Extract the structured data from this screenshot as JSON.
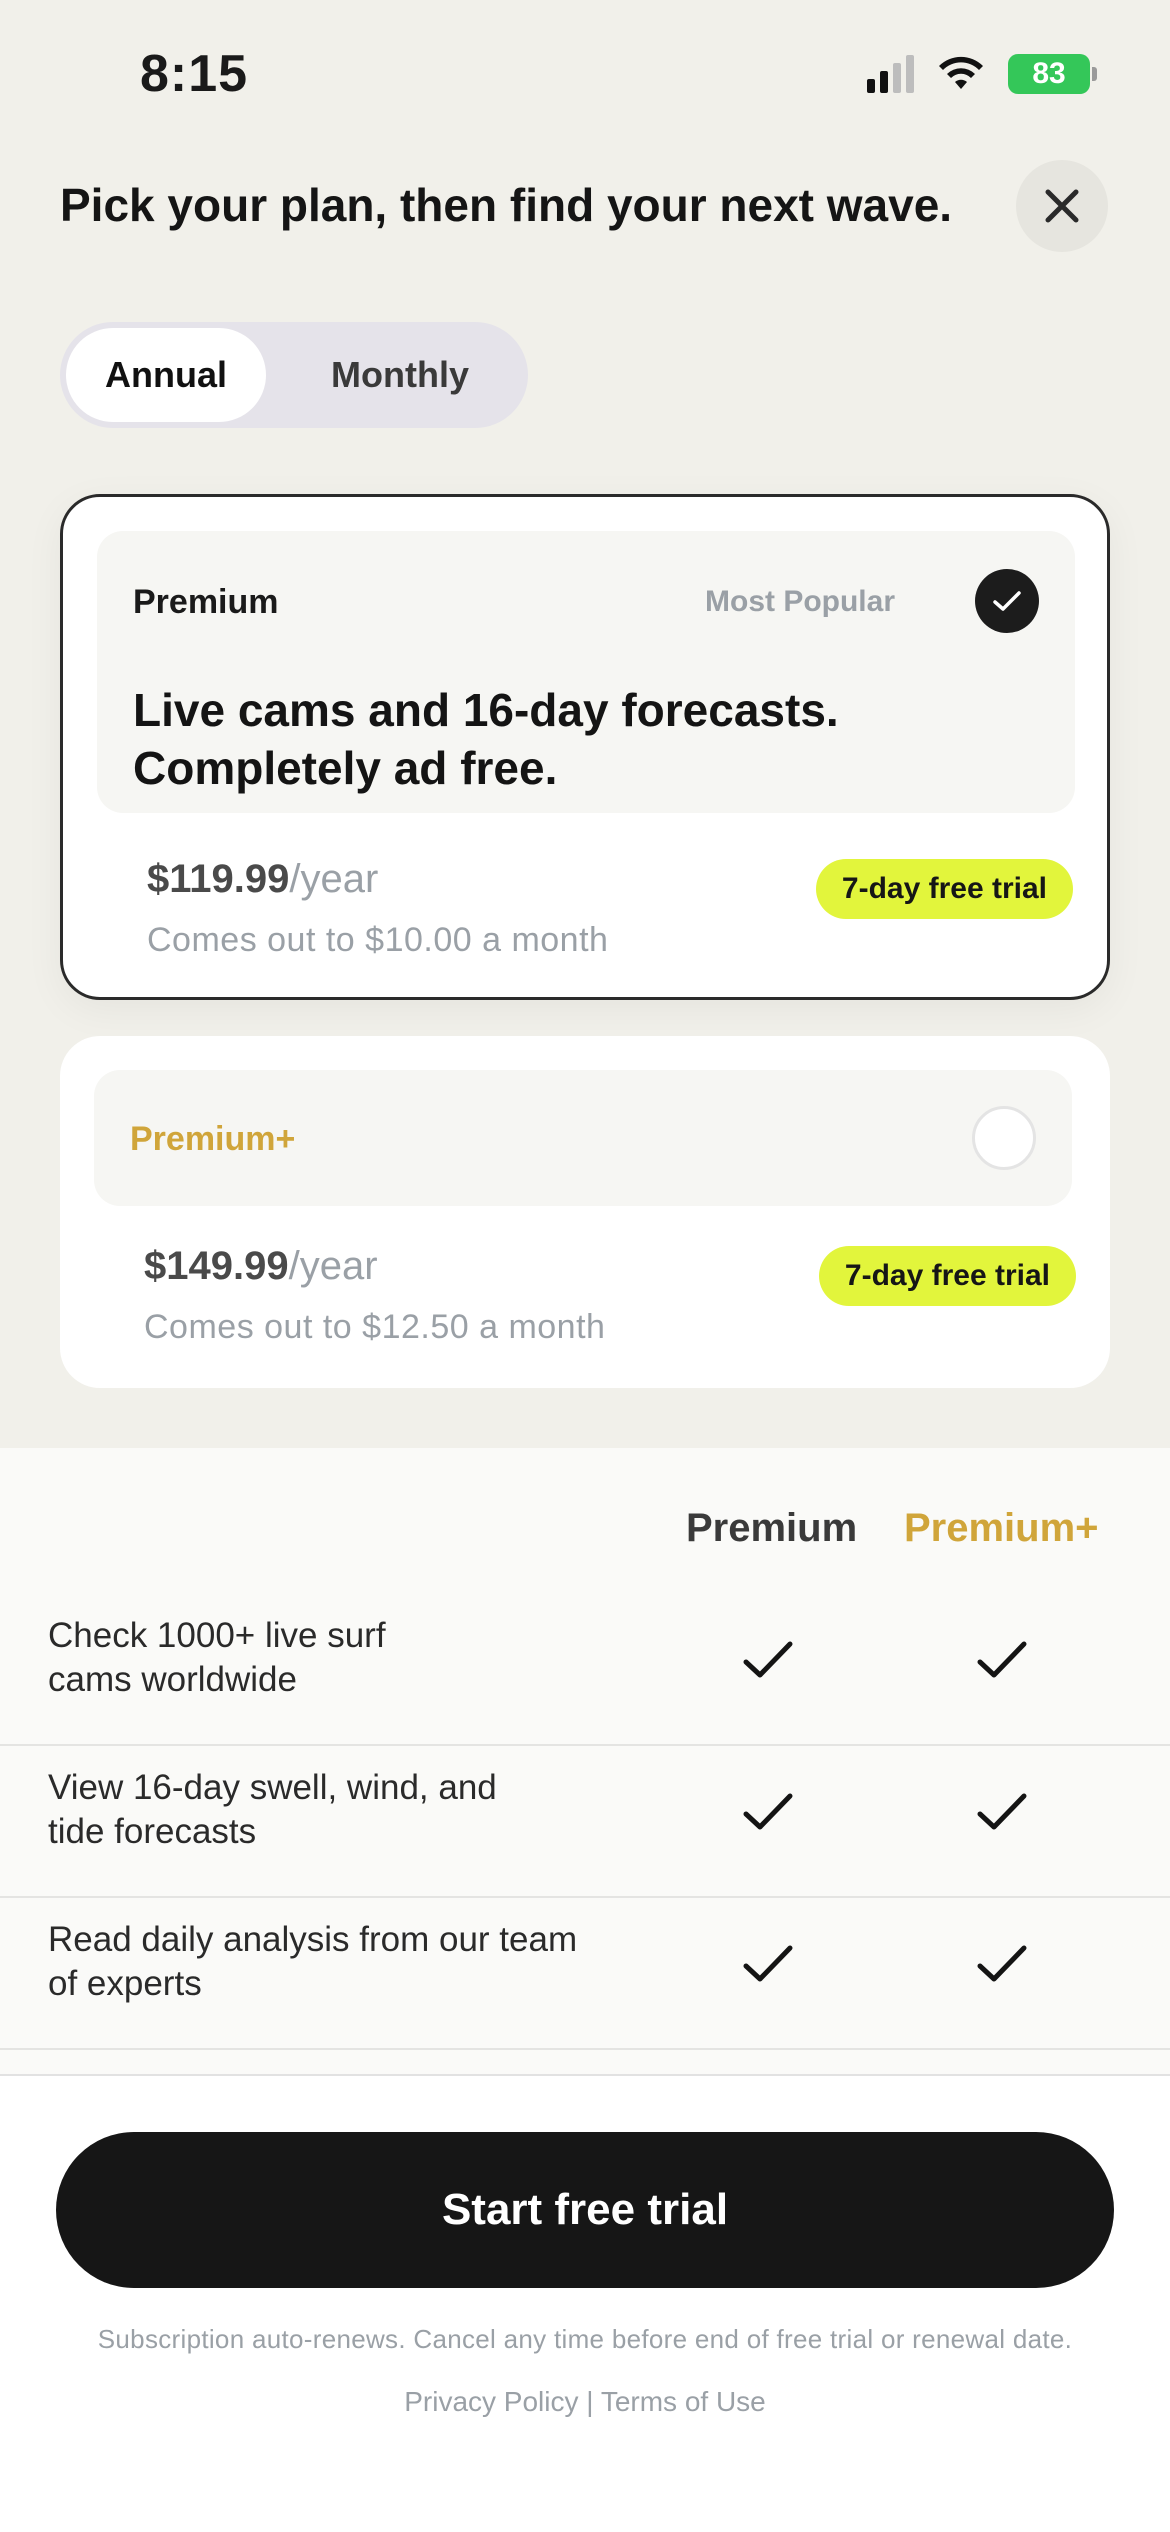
{
  "status_bar": {
    "time": "8:15",
    "battery": "83"
  },
  "header": {
    "title": "Pick your plan, then find your next wave."
  },
  "billing_toggle": {
    "annual": "Annual",
    "monthly": "Monthly",
    "selected": "Annual"
  },
  "plans": [
    {
      "name": "Premium",
      "badge": "Most Popular",
      "selected": true,
      "headline_line1": "Live cams and 16-day forecasts.",
      "headline_line2": "Completely ad free.",
      "price": "$119.99",
      "period": "/year",
      "monthly_equivalent": "Comes out to $10.00 a month",
      "trial": "7-day free trial"
    },
    {
      "name": "Premium+",
      "selected": false,
      "price": "$149.99",
      "period": "/year",
      "monthly_equivalent": "Comes out to $12.50 a month",
      "trial": "7-day free trial"
    }
  ],
  "comparison": {
    "columns": [
      "Premium",
      "Premium+"
    ],
    "rows": [
      {
        "line1": "Check 1000+ live surf",
        "line2": "cams worldwide"
      },
      {
        "line1": "View 16-day swell, wind, and",
        "line2": "tide forecasts"
      },
      {
        "line1": "Read daily analysis from our team",
        "line2": "of experts"
      }
    ]
  },
  "cta": {
    "label": "Start free trial",
    "disclaimer": "Subscription auto-renews. Cancel any time before end of free trial or renewal date.",
    "privacy": "Privacy Policy",
    "separator": "|",
    "terms": "Terms of Use"
  },
  "colors": {
    "background": "#f1f0ea",
    "accent_lime": "#e2f53c",
    "premium_plus_gold": "#d0a53a",
    "cta_black": "#161616"
  }
}
